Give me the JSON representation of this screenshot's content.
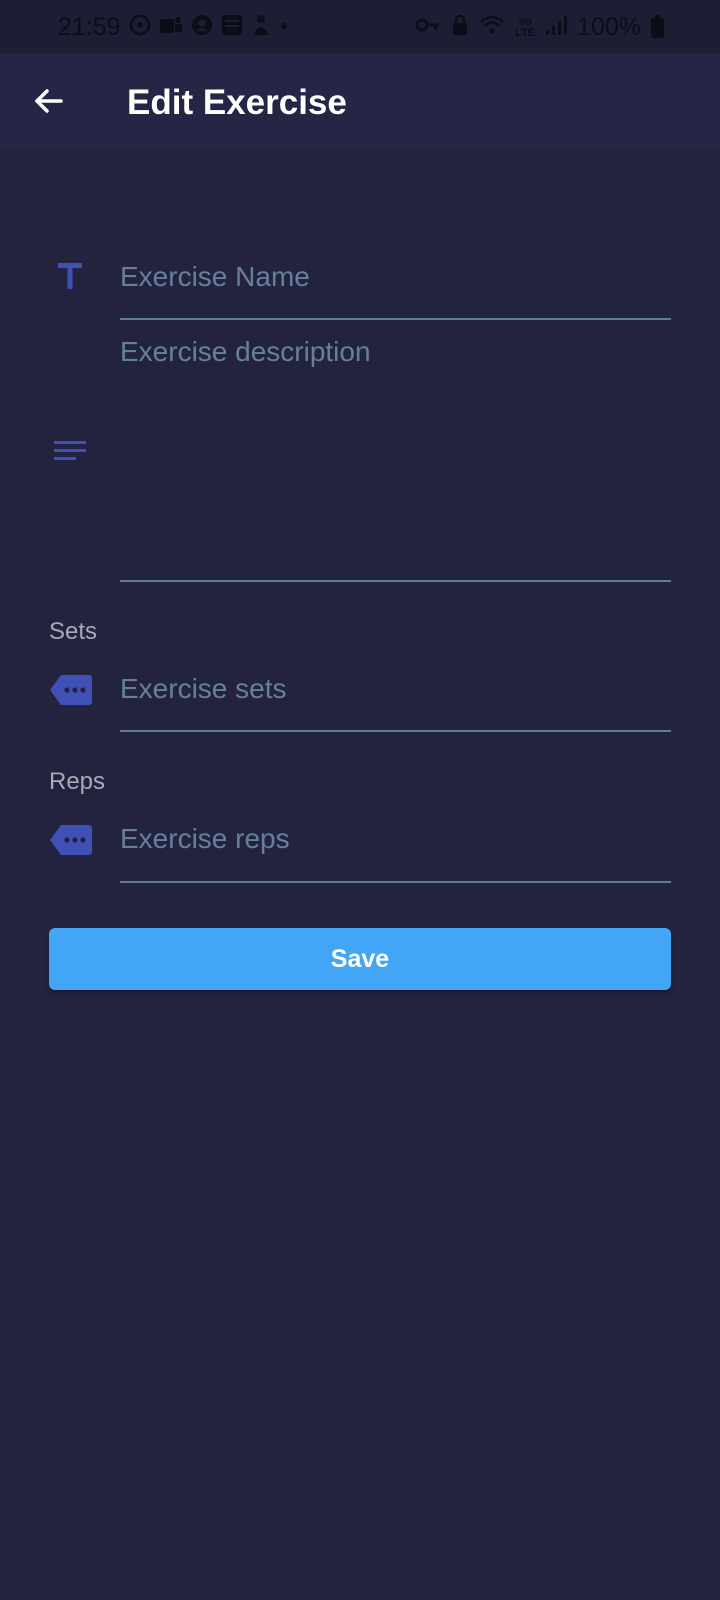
{
  "status_bar": {
    "time": "21:59",
    "battery_percent": "100%",
    "left_icons": [
      "whatsapp-icon",
      "teams-icon",
      "account-icon",
      "calendar-icon",
      "app-icon",
      "dot-icon"
    ],
    "right_icons": [
      "key-icon",
      "lock-icon",
      "wifi-icon",
      "volte-icon",
      "signal-icon",
      "battery-icon"
    ]
  },
  "app_bar": {
    "title": "Edit Exercise",
    "back_icon": "arrow-back-icon"
  },
  "form": {
    "name": {
      "placeholder": "Exercise Name",
      "value": "",
      "icon": "text-format-icon"
    },
    "description": {
      "placeholder": "Exercise description",
      "value": "",
      "icon": "notes-icon"
    },
    "sets": {
      "label": "Sets",
      "placeholder": "Exercise sets",
      "value": "",
      "icon": "tag-more-icon"
    },
    "reps": {
      "label": "Reps",
      "placeholder": "Exercise reps",
      "value": "",
      "icon": "tag-more-icon"
    }
  },
  "actions": {
    "save_label": "Save"
  },
  "colors": {
    "background": "#232340",
    "app_bar": "#252645",
    "status_bar": "#1d1d33",
    "accent_icon": "#3f51b5",
    "button": "#42a5f5",
    "placeholder": "#66809c",
    "underline": "#5f7c98"
  }
}
